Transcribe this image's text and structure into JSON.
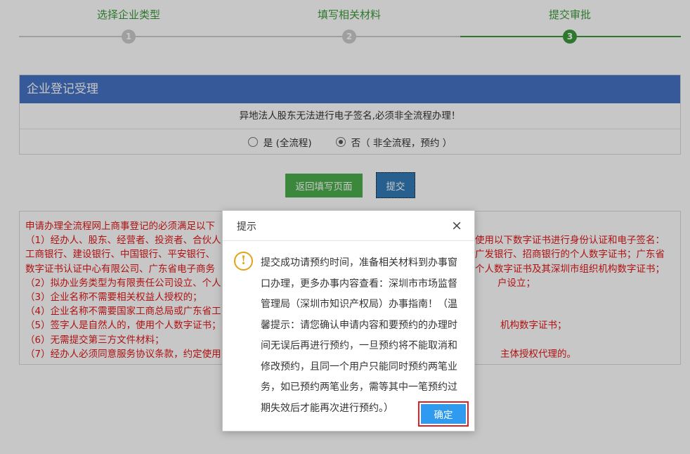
{
  "steps": [
    {
      "title": "选择企业类型",
      "number": "1",
      "state": "inactive"
    },
    {
      "title": "填写相关材料",
      "number": "2",
      "state": "inactive"
    },
    {
      "title": "提交审批",
      "number": "3",
      "state": "active"
    }
  ],
  "colors": {
    "step_active": "#3c9a3c",
    "step_inactive": "#cccccc",
    "panel_header": "#4472c4",
    "requirements_text": "#e01818"
  },
  "panel": {
    "title": "企业登记受理",
    "notice": "异地法人股东无法进行电子签名,必须非全流程办理！",
    "options": [
      {
        "label": "是 (全流程)",
        "selected": false
      },
      {
        "label": "否（ 非全流程，预约 ）",
        "selected": true
      }
    ]
  },
  "buttons": {
    "back": "返回填写页面",
    "submit": "提交"
  },
  "requirements": {
    "lines": [
      "申请办理全流程网上商事登记的必须满足以下",
      "（1）经办人、股东、经营者、投资者、合伙人",
      "工商银行、建设银行、中国银行、平安银行、",
      "数字证书认证中心有限公司、广东省电子商务",
      "（2）拟办业务类型为有限责任公司设立、个人",
      "（3）企业名称不需要相关权益人授权的；",
      "（4）企业名称不需要国家工商总局或广东省工",
      "（5）签字人是自然人的，使用个人数字证书；",
      "（6）无需提交第三方文件材料；",
      "（7）经办人必须同意服务协议条款，约定使用"
    ],
    "right_fragments": [
      "",
      "使用以下数字证书进行身份认证和电子签名：",
      "广发银行、招商银行的个人数字证书；广东省",
      "个人数字证书及其深圳市组织机构数字证书；",
      "户设立；",
      "",
      "",
      "机构数字证书；",
      "",
      "主体授权代理的。"
    ]
  },
  "dialog": {
    "title": "提示",
    "close_icon": "×",
    "warning_icon": "!",
    "message_lines": [
      "提交成功请预约时间，准备相关材料到办事窗",
      "口办理，更多办事内容查看：深圳市市场监督",
      "管理局（深圳市知识产权局）办事指南！（温",
      "馨提示：请您确认申请内容和要预约的办理时",
      "间无误后再进行预约，一旦预约将不能取消和",
      "修改预约，且同一个用户只能同时预约两笔业",
      "务，如已预约两笔业务，需等其中一笔预约过",
      "期失效后才能再次进行预约。）"
    ],
    "confirm": "确定"
  }
}
